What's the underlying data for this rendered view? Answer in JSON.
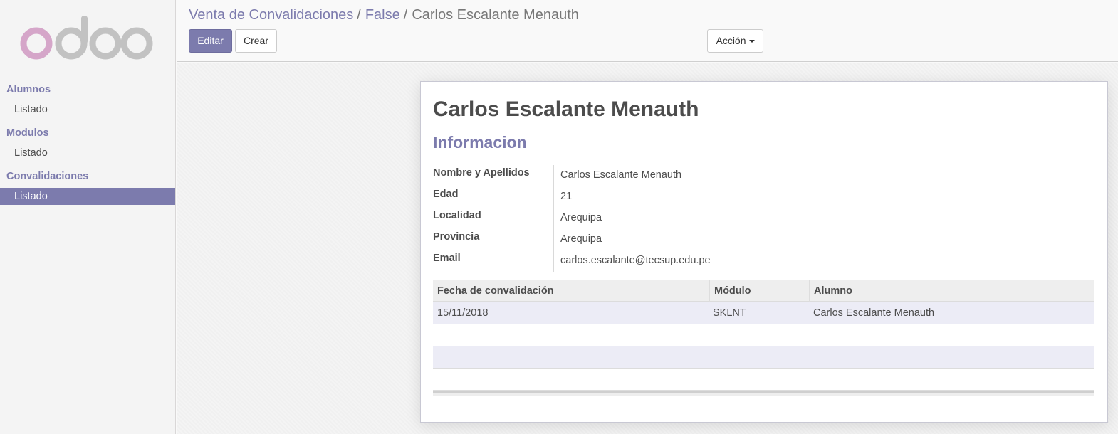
{
  "app": {
    "logo_text": "odoo",
    "brand_color": "#7c7bad"
  },
  "sidebar": {
    "sections": [
      {
        "label": "Alumnos",
        "items": [
          {
            "label": "Listado",
            "active": false
          }
        ]
      },
      {
        "label": "Modulos",
        "items": [
          {
            "label": "Listado",
            "active": false
          }
        ]
      },
      {
        "label": "Convalidaciones",
        "items": [
          {
            "label": "Listado",
            "active": true
          }
        ]
      }
    ]
  },
  "breadcrumb": {
    "items": [
      "Venta de Convalidaciones",
      "False"
    ],
    "separator": "/",
    "current": "Carlos Escalante Menauth"
  },
  "toolbar": {
    "edit_label": "Editar",
    "create_label": "Crear",
    "action_label": "Acción"
  },
  "record": {
    "title": "Carlos Escalante Menauth",
    "section_title": "Informacion",
    "fields": [
      {
        "label": "Nombre y Apellidos",
        "value": "Carlos Escalante Menauth"
      },
      {
        "label": "Edad",
        "value": "21"
      },
      {
        "label": "Localidad",
        "value": "Arequipa"
      },
      {
        "label": "Provincia",
        "value": "Arequipa"
      },
      {
        "label": "Email",
        "value": "carlos.escalante@tecsup.edu.pe"
      }
    ]
  },
  "table": {
    "columns": [
      "Fecha de convalidación",
      "Módulo",
      "Alumno"
    ],
    "rows": [
      [
        "15/11/2018",
        "SKLNT",
        "Carlos Escalante Menauth"
      ]
    ]
  }
}
